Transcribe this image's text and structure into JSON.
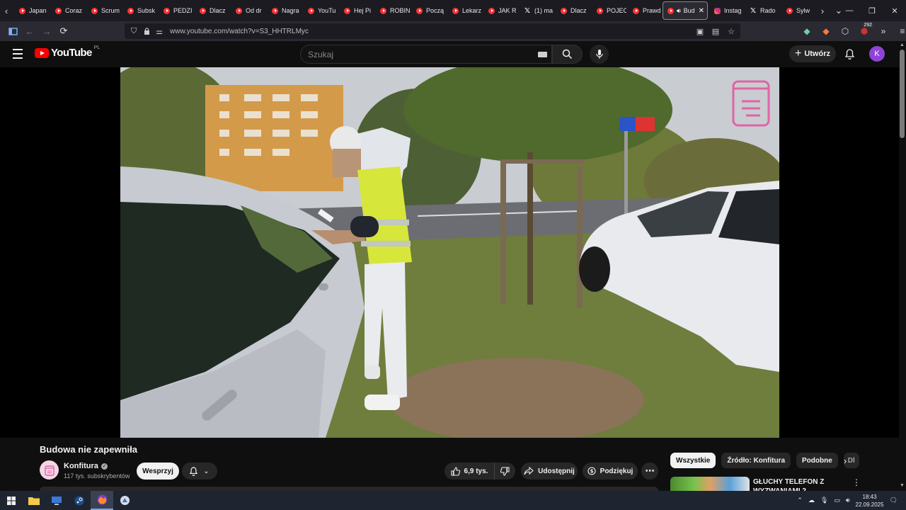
{
  "browser": {
    "tabs": [
      {
        "label": "Japan",
        "icon": "youtube-favicon"
      },
      {
        "label": "Coraz",
        "icon": "youtube-favicon"
      },
      {
        "label": "Scrum",
        "icon": "youtube-favicon"
      },
      {
        "label": "Subsk",
        "icon": "youtube-favicon"
      },
      {
        "label": "PEDZI",
        "icon": "youtube-favicon"
      },
      {
        "label": "Dlacz",
        "icon": "youtube-favicon"
      },
      {
        "label": "Od dr",
        "icon": "youtube-favicon"
      },
      {
        "label": "Nagra",
        "icon": "youtube-favicon"
      },
      {
        "label": "YouTu",
        "icon": "youtube-favicon"
      },
      {
        "label": "Hej Pi",
        "icon": "youtube-favicon"
      },
      {
        "label": "ROBIN",
        "icon": "youtube-favicon"
      },
      {
        "label": "Począ",
        "icon": "youtube-favicon"
      },
      {
        "label": "Lekarz",
        "icon": "youtube-favicon"
      },
      {
        "label": "JAK R",
        "icon": "youtube-favicon"
      },
      {
        "label": "(1) ma",
        "icon": "x-favicon"
      },
      {
        "label": "Dlacz",
        "icon": "youtube-favicon"
      },
      {
        "label": "POJEC",
        "icon": "youtube-favicon"
      },
      {
        "label": "Prawd",
        "icon": "youtube-favicon"
      }
    ],
    "active_tab": {
      "label": "Bud",
      "icon": "youtube-favicon"
    },
    "tabs_after": [
      {
        "label": "Instag",
        "icon": "instagram-favicon"
      },
      {
        "label": "Rado",
        "icon": "x-favicon"
      },
      {
        "label": "Sylw",
        "icon": "youtube-favicon"
      }
    ],
    "url": "www.youtube.com/watch?v=S3_HHTRLMyc",
    "extension_badge": "292"
  },
  "youtube": {
    "logo_text": "YouTube",
    "country_code": "PL",
    "search_placeholder": "Szukaj",
    "create_label": "Utwórz",
    "avatar_letter": "K",
    "accent_color": "#ff0000"
  },
  "video": {
    "title": "Budowa nie zapewniła",
    "channel_name": "Konfitura",
    "channel_subscribers": "117 tys. subskrybentów",
    "support_label": "Wesprzyj",
    "likes": "6,9 tys.",
    "share_label": "Udostępnij",
    "thanks_label": "Podziękuj"
  },
  "sidebar": {
    "chips": [
      "Wszystkie",
      "Źródło: Konfitura",
      "Podobne",
      "Dl"
    ],
    "recommendation_title": "GŁUCHY TELEFON Z WYZWANIAMI 2"
  },
  "taskbar": {
    "time": "18:43",
    "date": "22.09.2025"
  }
}
